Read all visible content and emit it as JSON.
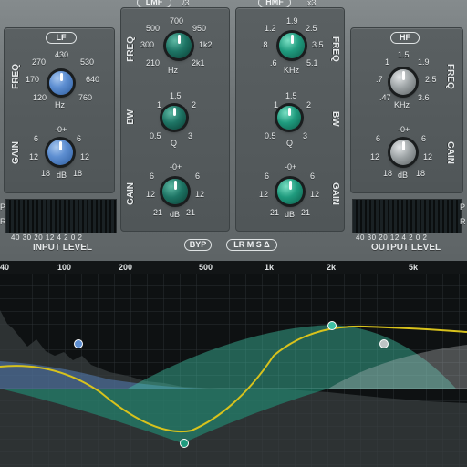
{
  "lf": {
    "title": "LF",
    "freq_label": "FREQ",
    "gain_label": "GAIN",
    "freq_scale": [
      "430",
      "270",
      "530",
      "170",
      "640",
      "120",
      "760"
    ],
    "freq_unit": "Hz",
    "gain_scale": [
      "-0+",
      "6",
      "6",
      "12",
      "12",
      "18",
      "18"
    ],
    "gain_unit": "dB"
  },
  "lmf": {
    "title": "LMF",
    "tag": "/3",
    "freq_label": "FREQ",
    "bw_label": "BW",
    "gain_label": "GAIN",
    "freq_scale": [
      "700",
      "500",
      "950",
      "300",
      "1k2",
      "210",
      "2k1"
    ],
    "freq_unit": "Hz",
    "bw_scale": [
      "1.5",
      "1",
      "2",
      "0.5",
      "3"
    ],
    "bw_unit": "Q",
    "gain_scale": [
      "-0+",
      "6",
      "6",
      "12",
      "12",
      "21",
      "21"
    ],
    "gain_unit": "dB"
  },
  "hmf": {
    "title": "HMF",
    "tag": "x3",
    "freq_label": "FREQ",
    "bw_label": "BW",
    "gain_label": "GAIN",
    "freq_scale": [
      "1.9",
      "1.2",
      "2.5",
      ".8",
      "3.5",
      ".6",
      "5.1"
    ],
    "freq_unit": "KHz",
    "bw_scale": [
      "1.5",
      "1",
      "2",
      "0.5",
      "3"
    ],
    "bw_unit": "Q",
    "gain_scale": [
      "-0+",
      "6",
      "6",
      "12",
      "12",
      "21",
      "21"
    ],
    "gain_unit": "dB"
  },
  "hf": {
    "title": "HF",
    "freq_label": "FREQ",
    "gain_label": "GAIN",
    "freq_scale": [
      "1.5",
      "1",
      "1.9",
      ".7",
      "2.5",
      ".47",
      "3.6"
    ],
    "freq_unit": "KHz",
    "gain_scale": [
      "-0+",
      "6",
      "6",
      "12",
      "12",
      "18",
      "18"
    ],
    "gain_unit": "dB"
  },
  "input": {
    "label": "INPUT LEVEL",
    "scale": "40 30 20 12 4 2 0 2",
    "ch_top": "P",
    "ch_bot": "R"
  },
  "output": {
    "label": "OUTPUT LEVEL",
    "scale": "40 30 20 12 4 2 0 2",
    "ch_top": "P",
    "ch_bot": "R"
  },
  "center": {
    "byp": "BYP",
    "mode": "LR M S Δ"
  },
  "freq_axis": [
    "40",
    "100",
    "200",
    "500",
    "1k",
    "2k",
    "5k"
  ],
  "colors": {
    "lf": "#5e8fd2",
    "lmf": "#1f9b7e",
    "hmf": "#3fc0a4",
    "hf": "#bfc4c6",
    "curve": "#d8c21c"
  }
}
